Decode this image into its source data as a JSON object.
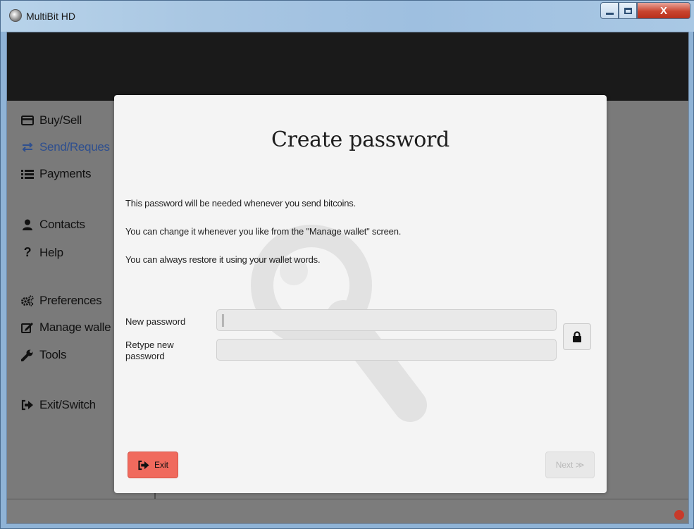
{
  "window": {
    "title": "MultiBit HD",
    "close_glyph": "X"
  },
  "sidebar": {
    "items": [
      {
        "label": "Buy/Sell",
        "icon": "credit-card-icon"
      },
      {
        "label": "Send/Reques",
        "icon": "exchange-arrows-icon"
      },
      {
        "label": "Payments",
        "icon": "list-icon"
      },
      {
        "label": "Contacts",
        "icon": "user-icon"
      },
      {
        "label": "Help",
        "icon": "question-icon"
      },
      {
        "label": "Preferences",
        "icon": "cogs-icon"
      },
      {
        "label": "Manage walle",
        "icon": "edit-icon"
      },
      {
        "label": "Tools",
        "icon": "wrench-icon"
      },
      {
        "label": "Exit/Switch",
        "icon": "sign-out-icon"
      }
    ],
    "active_index": 1
  },
  "modal": {
    "title": "Create password",
    "lines": [
      "This password will be needed whenever you send bitcoins.",
      "You can change it whenever you like from the \"Manage wallet\" screen.",
      "You can always restore it using your wallet words."
    ],
    "new_password_label": "New password",
    "retype_password_label": "Retype new password",
    "new_password_value": "",
    "retype_password_value": "",
    "exit_label": "Exit",
    "next_label": "Next ≫",
    "next_enabled": false
  },
  "colors": {
    "exit_button": "#f06a5d",
    "active_nav": "#2e4f8f",
    "status_dot": "#c83a2a"
  }
}
